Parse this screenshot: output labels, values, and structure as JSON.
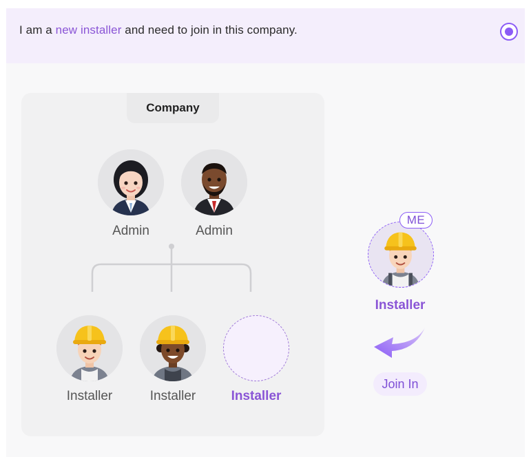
{
  "banner": {
    "text_before": "I am a ",
    "highlight": "new installer",
    "text_after": " and need to join in this company."
  },
  "company": {
    "title": "Company",
    "admins": [
      {
        "label": "Admin",
        "icon": "female-admin-avatar"
      },
      {
        "label": "Admin",
        "icon": "male-admin-avatar"
      }
    ],
    "installers": [
      {
        "label": "Installer",
        "icon": "installer-avatar-redhair"
      },
      {
        "label": "Installer",
        "icon": "installer-avatar-curly"
      },
      {
        "label": "Installer",
        "icon": "empty-slot"
      }
    ]
  },
  "me": {
    "badge": "ME",
    "label": "Installer",
    "icon": "installer-avatar-me"
  },
  "join": {
    "label": "Join In"
  },
  "colors": {
    "accent": "#8b5cf6",
    "accent_text": "#8a55d6",
    "banner_bg": "#f4eefc",
    "card_bg": "#f1f1f2"
  }
}
